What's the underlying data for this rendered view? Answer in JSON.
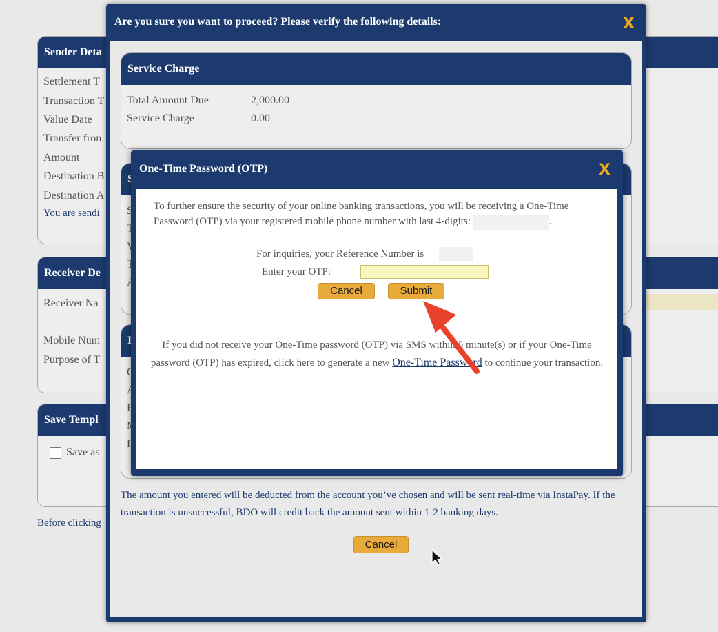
{
  "background": {
    "sender_panel": {
      "title": "Sender Deta",
      "rows": [
        "Settlement T",
        "Transaction T",
        "Value Date",
        "Transfer fron",
        "Amount",
        "Destination B",
        "Destination A"
      ],
      "note": "You are sendi"
    },
    "receiver_panel": {
      "title": "Receiver De",
      "rows": [
        "Receiver Na",
        "Mobile Num",
        "Purpose of T"
      ]
    },
    "template_panel": {
      "title": "Save Templ",
      "checkbox_label": "Save as"
    },
    "before_text": "Before clicking"
  },
  "confirm_dialog": {
    "title": "Are you sure you want to proceed? Please verify the following details:",
    "close_symbol": "X",
    "service_charge": {
      "title": "Service Charge",
      "rows": [
        {
          "label": "Total Amount Due",
          "value": "2,000.00"
        },
        {
          "label": "Service Charge",
          "value": "0.00"
        }
      ]
    },
    "hidden_panel_2_letters": [
      "S",
      "S",
      "T",
      "V",
      "T",
      "A"
    ],
    "hidden_panel_3_letters": [
      "I",
      "C",
      "A",
      "F",
      "M",
      "P"
    ],
    "note": "The amount you entered will be deducted from the account you’ve chosen and will be sent real-time via InstaPay. If the transaction is unsuccessful, BDO will credit back the amount sent within 1-2 banking days.",
    "cancel_label": "Cancel"
  },
  "otp_dialog": {
    "title": "One-Time Password (OTP)",
    "close_symbol": "X",
    "intro_part1": "To further ensure the security of your online banking transactions, you will be receiving a One-Time Password (OTP) via your registered mobile phone number with last 4-digits:",
    "intro_end": ".",
    "reference_label": "For inquiries, your Reference Number is",
    "enter_label": "Enter your OTP:",
    "otp_value": "",
    "cancel_label": "Cancel",
    "submit_label": "Submit",
    "resend_text_before": "If you did not receive your One-Time password (OTP) via SMS within 5 minute(s) or if your One-Time password (OTP) has expired, click here to generate a new",
    "resend_link": "One-Time Password",
    "resend_text_after": "to continue your transaction."
  },
  "colors": {
    "header_blue": "#1c3a6e",
    "button_gold": "#e8aa3b",
    "close_orange": "#f0a91d",
    "arrow_red": "#e8412c",
    "input_yellow": "#fbf7c0"
  }
}
